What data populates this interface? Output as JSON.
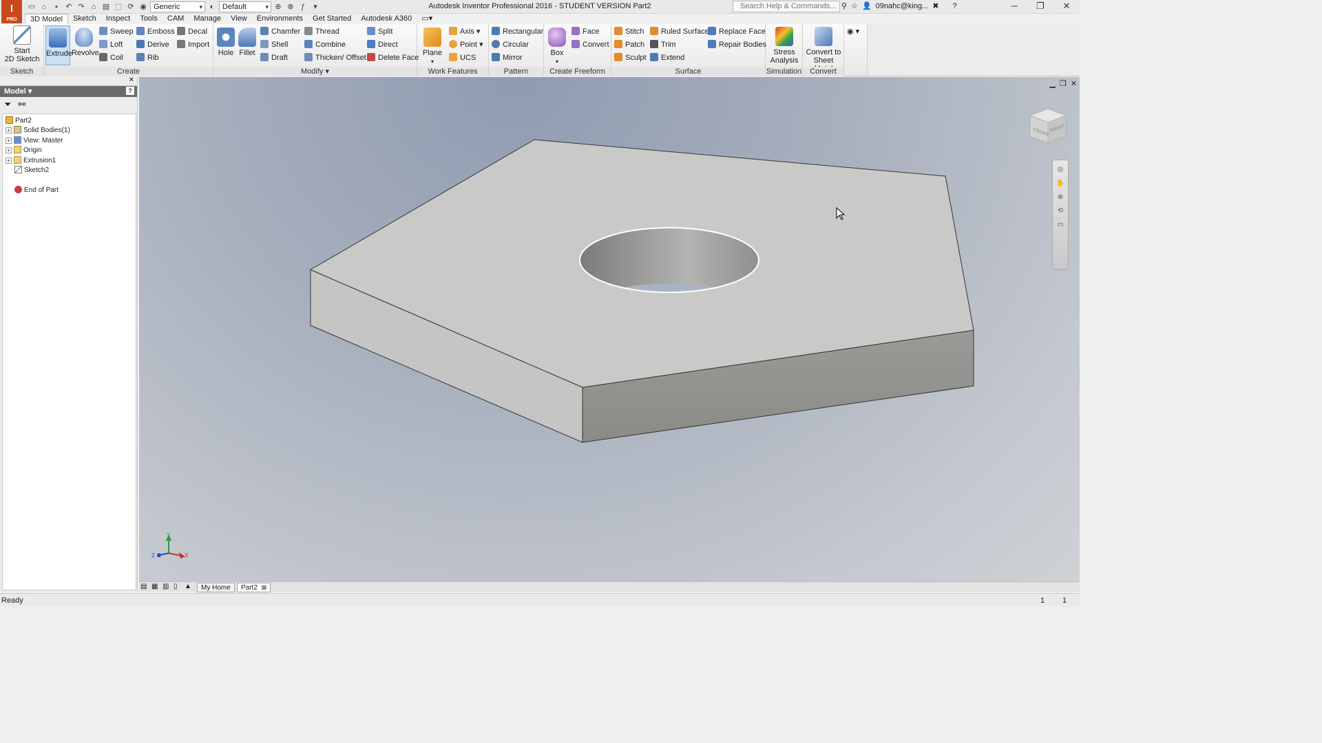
{
  "app": {
    "logo_text": "I",
    "logo_badge": "PRO",
    "window_title": "Autodesk Inventor Professional 2016 - STUDENT VERSION   Part2",
    "search_placeholder": "Search Help & Commands...",
    "user": "09nahc@king...",
    "qat_style_combo": "Generic",
    "qat_appearance_combo": "Default"
  },
  "tabs": [
    {
      "label": "3D Model",
      "active": true
    },
    {
      "label": "Sketch"
    },
    {
      "label": "Inspect"
    },
    {
      "label": "Tools"
    },
    {
      "label": "CAM"
    },
    {
      "label": "Manage"
    },
    {
      "label": "View"
    },
    {
      "label": "Environments"
    },
    {
      "label": "Get Started"
    },
    {
      "label": "Autodesk A360"
    }
  ],
  "ribbon": {
    "panels": {
      "sketch": "Sketch",
      "create": "Create",
      "modify": "Modify ▾",
      "work_features": "Work Features",
      "pattern": "Pattern",
      "create_freeform": "Create Freeform",
      "surface": "Surface",
      "simulation": "Simulation",
      "convert": "Convert"
    },
    "start_sketch_line1": "Start",
    "start_sketch_line2": "2D Sketch",
    "extrude": "Extrude",
    "revolve": "Revolve",
    "sweep": "Sweep",
    "loft": "Loft",
    "coil": "Coil",
    "emboss": "Emboss",
    "derive": "Derive",
    "rib": "Rib",
    "decal": "Decal",
    "import": "Import",
    "hole": "Hole",
    "fillet": "Fillet",
    "chamfer": "Chamfer",
    "shell": "Shell",
    "draft": "Draft",
    "thread": "Thread",
    "combine": "Combine",
    "thicken": "Thicken/ Offset",
    "split": "Split",
    "direct": "Direct",
    "delete_face": "Delete Face",
    "plane": "Plane",
    "axis": "Axis",
    "point": "Point",
    "ucs": "UCS",
    "rectangular": "Rectangular",
    "circular": "Circular",
    "mirror": "Mirror",
    "box": "Box",
    "face": "Face",
    "convert_ff": "Convert",
    "stitch": "Stitch",
    "patch": "Patch",
    "sculpt": "Sculpt",
    "ruled_surface": "Ruled Surface",
    "trim": "Trim",
    "extend": "Extend",
    "replace_face": "Replace Face",
    "repair_bodies": "Repair Bodies",
    "stress_line1": "Stress",
    "stress_line2": "Analysis",
    "convert_sm_line1": "Convert to",
    "convert_sm_line2": "Sheet Metal"
  },
  "browser": {
    "title": "Model ▾",
    "tree": [
      {
        "label": "Part2"
      },
      {
        "label": "Solid Bodies(1)"
      },
      {
        "label": "View: Master"
      },
      {
        "label": "Origin"
      },
      {
        "label": "Extrusion1"
      },
      {
        "label": "Sketch2"
      },
      {
        "label": "End of Part"
      }
    ]
  },
  "viewcube": {
    "front": "FRONT",
    "right": "RIGHT"
  },
  "triad": {
    "x": "X",
    "y": "Y",
    "z": "Z"
  },
  "doc_tabs": [
    {
      "label": "My Home"
    },
    {
      "label": "Part2"
    }
  ],
  "status": {
    "left": "Ready",
    "count1": "1",
    "count2": "1"
  },
  "colors": {
    "logo": "#c8491e",
    "selected_button": "#c9e0f7",
    "part_top": "#c9c9c7",
    "part_side": "#8e8e8a"
  }
}
